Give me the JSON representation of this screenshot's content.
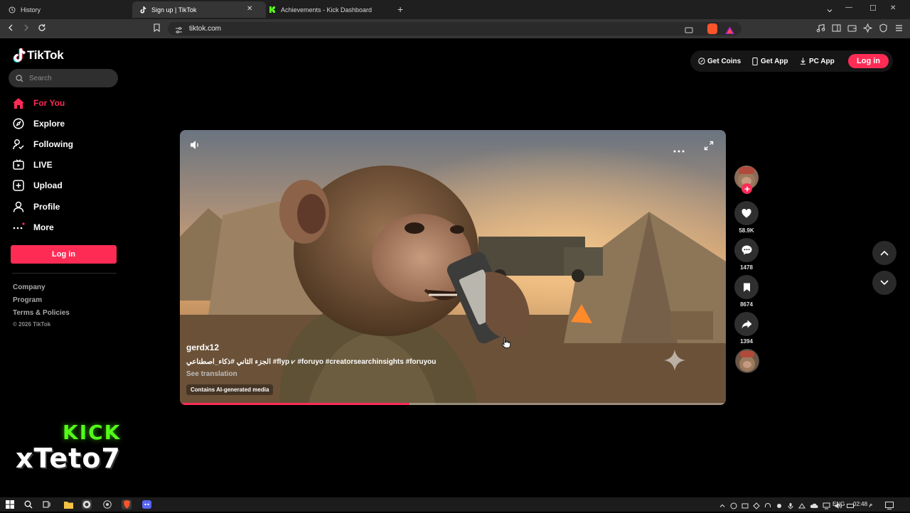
{
  "browser": {
    "tabs": [
      {
        "label": "History"
      },
      {
        "label": "Sign up | TikTok"
      },
      {
        "label": "Achievements - Kick Dashboard"
      }
    ],
    "new_tab": "+",
    "url": "tiktok.com",
    "window_controls": {
      "minimize": "—",
      "maximize": "☐",
      "close": "✕"
    }
  },
  "tiktok": {
    "logo": "TikTok",
    "search_placeholder": "Search",
    "nav": [
      {
        "label": "For You",
        "icon": "home-icon",
        "active": true
      },
      {
        "label": "Explore",
        "icon": "compass-icon"
      },
      {
        "label": "Following",
        "icon": "following-icon"
      },
      {
        "label": "LIVE",
        "icon": "live-icon"
      },
      {
        "label": "Upload",
        "icon": "upload-icon"
      },
      {
        "label": "Profile",
        "icon": "profile-icon"
      },
      {
        "label": "More",
        "icon": "more-icon"
      }
    ],
    "login_label": "Log in",
    "footer": [
      "Company",
      "Program",
      "Terms & Policies",
      "© 2026 TikTok"
    ],
    "header_buttons": {
      "coins": "Get Coins",
      "app": "Get App",
      "pc": "PC App",
      "login": "Log in"
    },
    "video": {
      "username": "gerdx12",
      "caption": "الجزء الثاني #ذكاء_اصطناعي #flyp ⩗ #foruyo #creatorsearchinsights #foruyou",
      "see_translation": "See translation",
      "ai_label": "Contains AI-generated media",
      "progress": 0.42
    },
    "actions": {
      "likes": "58.9K",
      "comments": "1478",
      "saves": "8674",
      "shares": "1394"
    }
  },
  "overlay": {
    "line1": "KICK",
    "line2": "xTeto7"
  },
  "taskbar": {
    "lang": "ENG",
    "time": "02:48 م"
  },
  "colors": {
    "brand": "#fe2c55",
    "kick": "#53fc18"
  }
}
